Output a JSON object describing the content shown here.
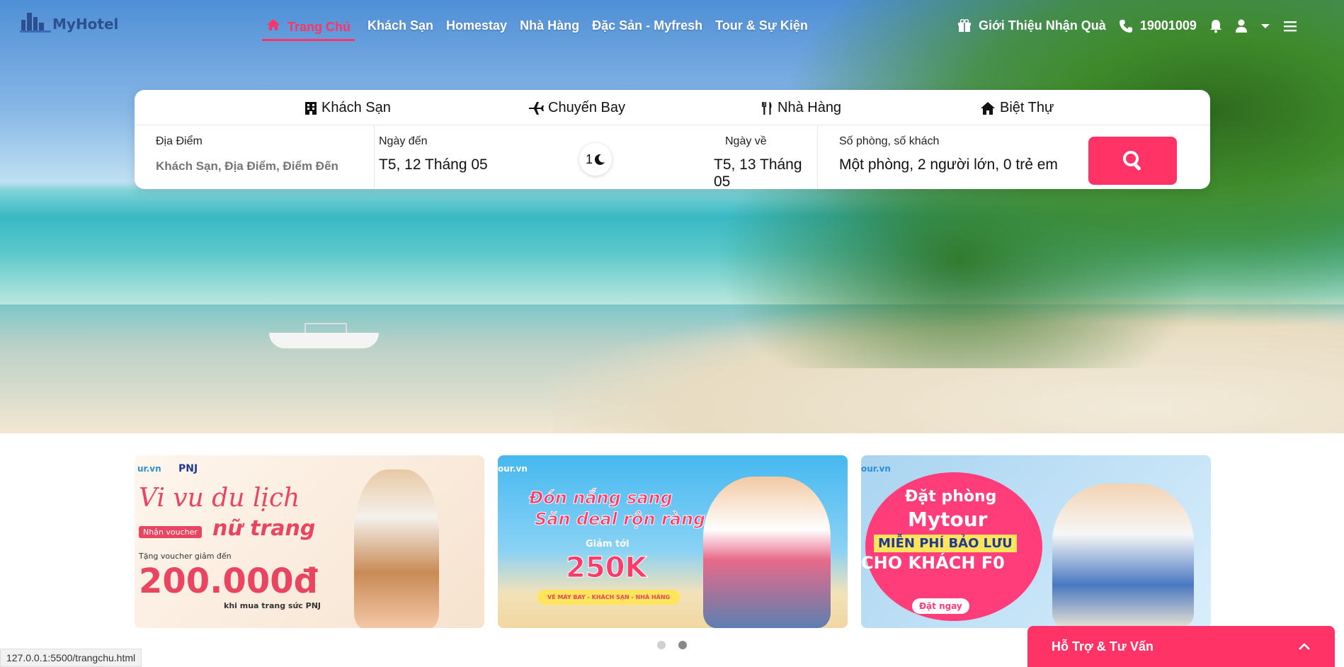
{
  "brand": {
    "logo_text": "MyHotel"
  },
  "nav": {
    "items": [
      {
        "label": "Trang Chủ",
        "active": true
      },
      {
        "label": "Khách Sạn"
      },
      {
        "label": "Homestay"
      },
      {
        "label": "Nhà Hàng"
      },
      {
        "label": "Đặc Sản - Myfresh"
      },
      {
        "label": "Tour & Sự Kiện"
      }
    ],
    "referral": "Giới Thiệu Nhận Quà",
    "phone": "19001009",
    "icons": [
      "gift-icon",
      "phone-icon",
      "bell-icon",
      "user-icon",
      "caret-down-icon",
      "menu-icon"
    ]
  },
  "search": {
    "tabs": [
      {
        "label": "Khách Sạn",
        "icon": "hotel-icon"
      },
      {
        "label": "Chuyến Bay",
        "icon": "plane-icon"
      },
      {
        "label": "Nhà Hàng",
        "icon": "utensils-icon"
      },
      {
        "label": "Biệt Thự",
        "icon": "house-icon"
      }
    ],
    "location_label": "Địa Điểm",
    "location_placeholder": "Khách Sạn, Địa Điểm, Điểm Đến",
    "checkin_label": "Ngày đến",
    "checkin_value": "T5, 12 Tháng 05",
    "nights": "1",
    "checkout_label": "Ngày về",
    "checkout_value": "T5, 13 Tháng 05",
    "guests_label": "Số phòng, số khách",
    "guests_value": "Một phòng, 2 người lớn, 0 trẻ em"
  },
  "banners": [
    {
      "brand": "ur.vn",
      "partner": "PNJ",
      "headline1": "Vi vu du lịch",
      "tag": "Nhận voucher",
      "headline2": "nữ trang",
      "sub": "Tặng voucher giảm đến",
      "amount": "200.000đ",
      "note": "khi mua trang sức PNJ"
    },
    {
      "brand": "our.vn",
      "headline1": "Đón nắng sang",
      "headline2": "Săn deal rộn ràng",
      "sub": "Giảm tới",
      "amount": "250K",
      "note": "VÉ MÁY BAY - KHÁCH SẠN - NHÀ HÀNG"
    },
    {
      "brand": "our.vn",
      "headline1": "Đặt phòng",
      "headline2": "Mytour",
      "sub": "MIỄN PHÍ BẢO LƯU",
      "amount": "CHO KHÁCH F0",
      "cta": "Đặt ngay"
    }
  ],
  "carousel": {
    "count": 2,
    "active": 2
  },
  "status_url": "127.0.0.1:5500/trangchu.html",
  "support": {
    "label": "Hỗ Trợ & Tư Vấn"
  },
  "colors": {
    "accent": "#ff3366",
    "brand_blue": "#2b4f8f"
  }
}
